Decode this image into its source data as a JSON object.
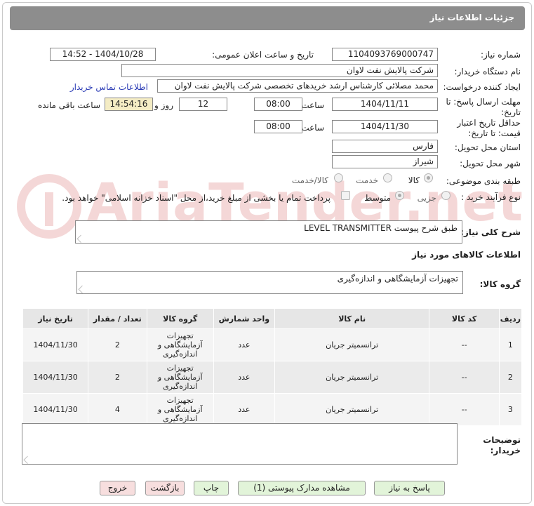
{
  "header": {
    "title": "جزئیات اطلاعات نیاز"
  },
  "watermark": {
    "text": "AriaTender.net"
  },
  "form": {
    "need_number_label": "شماره نیاز:",
    "need_number": "1104093769000747",
    "announce_label": "تاریخ و ساعت اعلان عمومی:",
    "announce_value": "1404/10/28 - 14:52",
    "buyer_org_label": "نام دستگاه خریدار:",
    "buyer_org": "شرکت پالایش نفت لاوان",
    "creator_label": "ایجاد کننده درخواست:",
    "creator": "محمد مصلائی کارشناس ارشد خریدهای تخصصی شرکت پالایش نفت لاوان",
    "contact_link": "اطلاعات تماس خریدار",
    "deadline_label_1": "مهلت ارسال پاسخ: تا",
    "deadline_label_2": "تاریخ:",
    "deadline_date": "1404/11/11",
    "time_label": "ساعت",
    "deadline_time": "08:00",
    "days_value": "12",
    "days_label": "روز و",
    "remaining_time": "14:54:16",
    "remaining_label": "ساعت باقی مانده",
    "validity_label_1": "حداقل تاریخ اعتبار",
    "validity_label_2": "قیمت: تا تاریخ:",
    "validity_date": "1404/11/30",
    "validity_time": "08:00",
    "province_label": "استان محل تحویل:",
    "province": "فارس",
    "city_label": "شهر محل تحویل:",
    "city": "شیراز",
    "category_label": "طبقه بندی موضوعی:",
    "category_options": [
      "کالا",
      "خدمت",
      "کالا/خدمت"
    ],
    "process_label": "نوع فرآیند خرید :",
    "process_options": [
      "جزیی",
      "متوسط"
    ],
    "payment_note": "پرداخت تمام یا بخشی از مبلغ خرید،از محل \"اسناد خزانه اسلامی\" خواهد بود.",
    "description_label": "شرح کلی نیاز:",
    "description": "LEVEL TRANSMITTER طبق شرح پیوست",
    "goods_info_title": "اطلاعات کالاهای مورد نیاز",
    "goods_group_label": "گروه کالا:",
    "goods_group": "تجهیزات آزمایشگاهی و اندازه‌گیری",
    "buyer_notes_label_1": "توضیحات",
    "buyer_notes_label_2": "خریدار:",
    "buyer_notes": ""
  },
  "table": {
    "headers": [
      "ردیف",
      "کد کالا",
      "نام کالا",
      "واحد شمارش",
      "گروه کالا",
      "تعداد / مقدار",
      "تاریخ نیاز"
    ],
    "rows": [
      {
        "row": "1",
        "code": "--",
        "name": "ترانسمیتر جریان",
        "unit": "عدد",
        "group_1": "تجهیزات",
        "group_2": "آزمایشگاهی و",
        "group_3": "اندازه‌گیری",
        "qty": "2",
        "date": "1404/11/30"
      },
      {
        "row": "2",
        "code": "--",
        "name": "ترانسمیتر جریان",
        "unit": "عدد",
        "group_1": "تجهیزات",
        "group_2": "آزمایشگاهی و",
        "group_3": "اندازه‌گیری",
        "qty": "2",
        "date": "1404/11/30"
      },
      {
        "row": "3",
        "code": "--",
        "name": "ترانسمیتر جریان",
        "unit": "عدد",
        "group_1": "تجهیزات",
        "group_2": "آزمایشگاهی و",
        "group_3": "اندازه‌گیری",
        "qty": "4",
        "date": "1404/11/30"
      }
    ]
  },
  "buttons": {
    "reply": "پاسخ به نیاز",
    "attachments": "مشاهده مدارک پیوستی (1)",
    "print": "چاپ",
    "back": "بازگشت",
    "exit": "خروج"
  },
  "colors": {
    "header_bg": "#8d8d8d",
    "link": "#2a3bb5",
    "button_green": "#e2f4d9",
    "button_red": "#f7dede",
    "remaining_bg": "#f4ecc4"
  }
}
